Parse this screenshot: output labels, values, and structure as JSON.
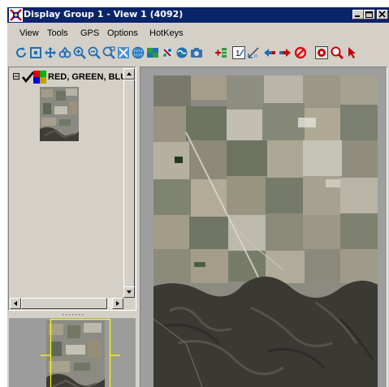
{
  "window": {
    "title": "Display Group 1 - View 1 (4092)",
    "controls": [
      "minimize",
      "maximize",
      "close"
    ]
  },
  "menu": {
    "items": [
      "View",
      "Tools",
      "GPS",
      "Options",
      "HotKeys"
    ]
  },
  "toolbar": {
    "icons": [
      "refresh-icon",
      "extents-icon",
      "pan-icon",
      "navigate-icon",
      "zoom-in-icon",
      "zoom-out-icon",
      "zoom-box-icon",
      "zoom-full-icon",
      "globe-icon",
      "layers-icon",
      "disconnect-icon",
      "globe-2-icon",
      "camera-icon",
      "add-layer-icon",
      "one-to-one-icon",
      "measure-icon",
      "previous-icon",
      "next-icon",
      "cancel-icon",
      "select-mode-icon",
      "zoom-mode-icon",
      "pointer-icon"
    ]
  },
  "layers": {
    "expander": "⊟",
    "items": [
      {
        "label": "RED, GREEN, BLU",
        "checked": true
      }
    ]
  },
  "colors": {
    "title_bar": "#0a246a",
    "window_bg": "#d4d0c8",
    "view_bg": "#9e9e9e",
    "overview_frame": "#ffff00"
  }
}
